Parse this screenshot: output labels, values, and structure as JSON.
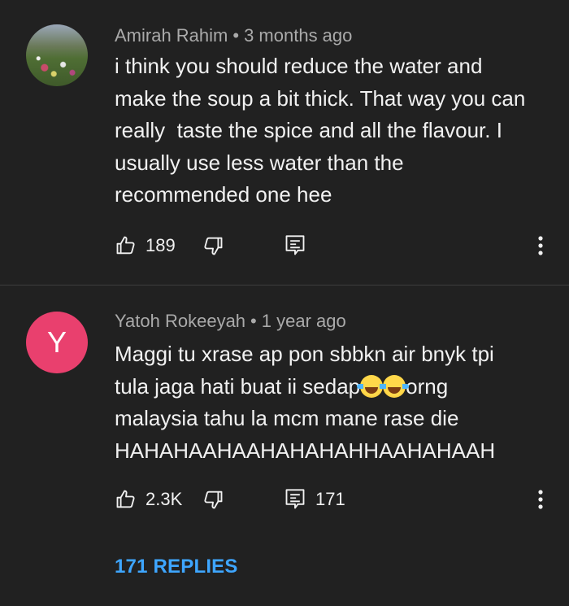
{
  "comments": [
    {
      "author": "Amirah Rahim",
      "separator": "•",
      "time": "3 months ago",
      "lines": [
        "i think you should reduce the water and",
        "make the soup a bit thick. That way you can",
        "really  taste the spice and all the flavour. I",
        "usually use less water than the",
        "recommended one hee"
      ],
      "likes": "189",
      "avatar_type": "photo"
    },
    {
      "author": "Yatoh Rokeeyah",
      "separator": "•",
      "time": "1 year ago",
      "avatar_letter": "Y",
      "avatar_color": "#e9406e",
      "lines_before_emoji": "tula jaga hati buat ii sedap",
      "lines_after_emoji": "orng",
      "line1": "Maggi tu xrase ap pon sbbkn air bnyk tpi",
      "line3": "malaysia tahu la mcm mane rase die",
      "line4": "HAHAHAAHAAHAHAHAHHAAHAHAAH",
      "emoji_name": "face-with-tears-of-joy",
      "likes": "2.3K",
      "reply_count": "171",
      "replies_link": "171 REPLIES"
    }
  ],
  "icons": {
    "like": "thumbs-up-icon",
    "dislike": "thumbs-down-icon",
    "reply": "comment-reply-icon",
    "more": "more-vertical-icon"
  },
  "colors": {
    "background": "#212121",
    "text": "#f1f1f1",
    "meta": "#aaaaaa",
    "link": "#3ea6ff",
    "divider": "#3d3d3d"
  }
}
